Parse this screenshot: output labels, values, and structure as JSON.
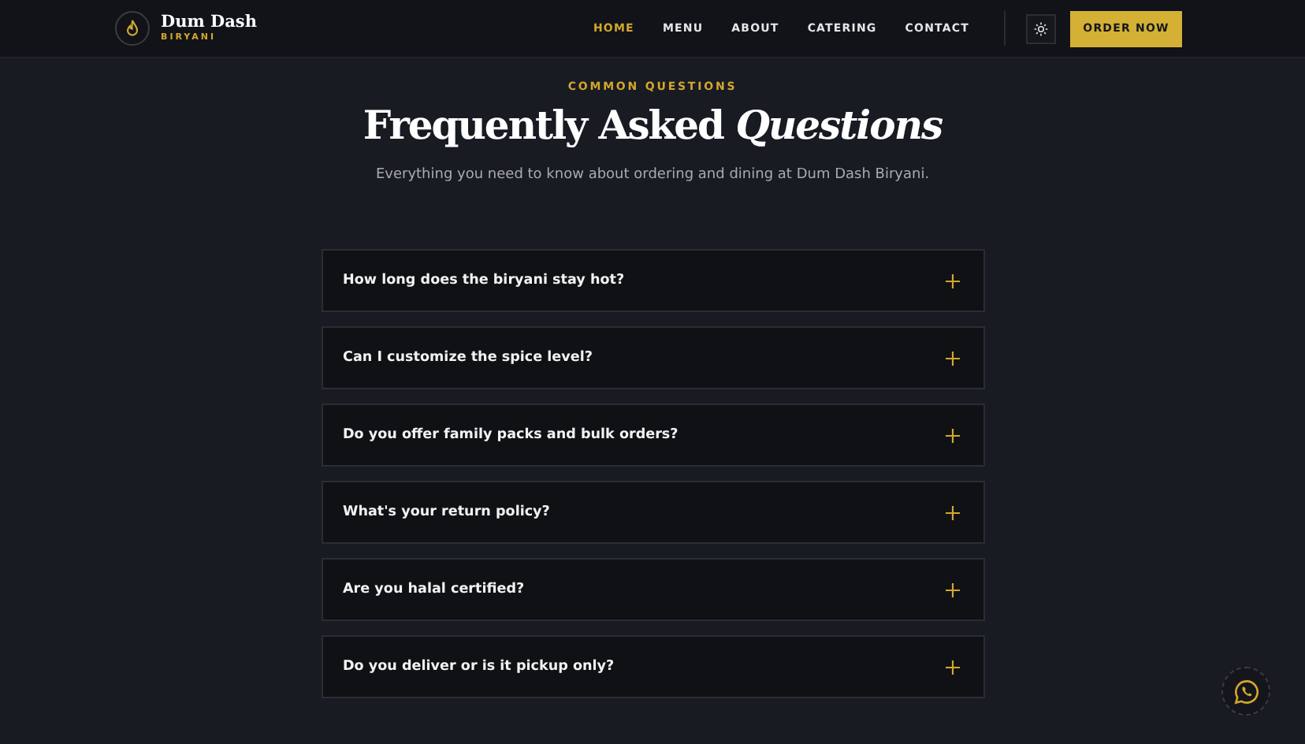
{
  "brand": {
    "name": "Dum Dash",
    "tagline": "BIRYANI"
  },
  "nav": [
    {
      "label": "HOME",
      "selected": true
    },
    {
      "label": "MENU",
      "selected": false
    },
    {
      "label": "ABOUT",
      "selected": false
    },
    {
      "label": "CATERING",
      "selected": false
    },
    {
      "label": "CONTACT",
      "selected": false
    }
  ],
  "order_button": "ORDER NOW",
  "section": {
    "eyebrow": "COMMON QUESTIONS",
    "title": "Frequently Asked *Questions*",
    "subtitle": "Everything you need to know about ordering and dining at Dum Dash Biryani."
  },
  "faqs": [
    {
      "question": "How long does the biryani stay hot?",
      "expanded": false
    },
    {
      "question": "Can I customize the spice level?",
      "expanded": false
    },
    {
      "question": "Do you offer family packs and bulk orders?",
      "expanded": false
    },
    {
      "question": "What's your return policy?",
      "expanded": false
    },
    {
      "question": "Are you halal certified?",
      "expanded": false
    },
    {
      "question": "Do you deliver or is it pickup only?",
      "expanded": false
    }
  ]
}
